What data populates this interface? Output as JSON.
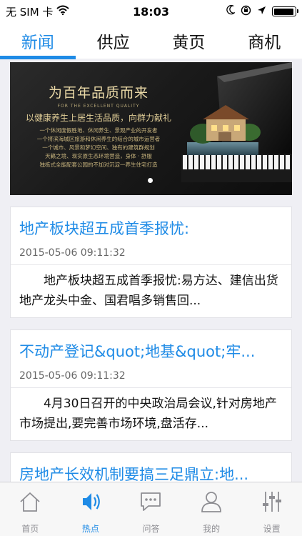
{
  "status": {
    "carrier": "无 SIM 卡",
    "time": "18:03",
    "battery_level": 0.95
  },
  "top_tabs": [
    {
      "label": "新闻",
      "active": true
    },
    {
      "label": "供应",
      "active": false
    },
    {
      "label": "黄页",
      "active": false
    },
    {
      "label": "商机",
      "active": false
    }
  ],
  "banner": {
    "title": "为百年品质而来",
    "subtitle_en": "FOR THE EXCELLENT QUALITY",
    "slogan": "以健康养生上居生活品质，向群力献礼",
    "lines": [
      "一个休闲度假胜地、休闲养生、景观产业的开发者",
      "一个将滨海城区旅游和休闲养生的结合的城市运营者",
      "一个城市、风景和梦幻空间、独有的建筑群规划",
      "天籁之境、现实原生态环境营造，身体 · 舒服",
      "独栋式全能配套公园的不加对沉淀一养生住宅打造"
    ],
    "page_count": 1
  },
  "news": [
    {
      "title": "地产板块超五成首季报忧:",
      "date": "2015-05-06 09:11:32",
      "summary": "地产板块超五成首季报忧:易方达、建信出货地产龙头中金、国君唱多销售回..."
    },
    {
      "title": "不动产登记&quot;地基&quot;牢...",
      "date": "2015-05-06 09:11:32",
      "summary": "4月30日召开的中央政治局会议,针对房地产市场提出,要完善市场环境,盘活存..."
    },
    {
      "title": "房地产长效机制要搞三足鼎立:地...",
      "date": "",
      "summary": ""
    }
  ],
  "bottom_tabs": [
    {
      "label": "首页",
      "icon": "home-icon",
      "active": false
    },
    {
      "label": "热点",
      "icon": "speaker-icon",
      "active": true
    },
    {
      "label": "问答",
      "icon": "chat-icon",
      "active": false
    },
    {
      "label": "我的",
      "icon": "person-icon",
      "active": false
    },
    {
      "label": "设置",
      "icon": "sliders-icon",
      "active": false
    }
  ],
  "colors": {
    "accent": "#1f8be6",
    "inactive": "#8e8e93",
    "background": "#efeff4"
  }
}
